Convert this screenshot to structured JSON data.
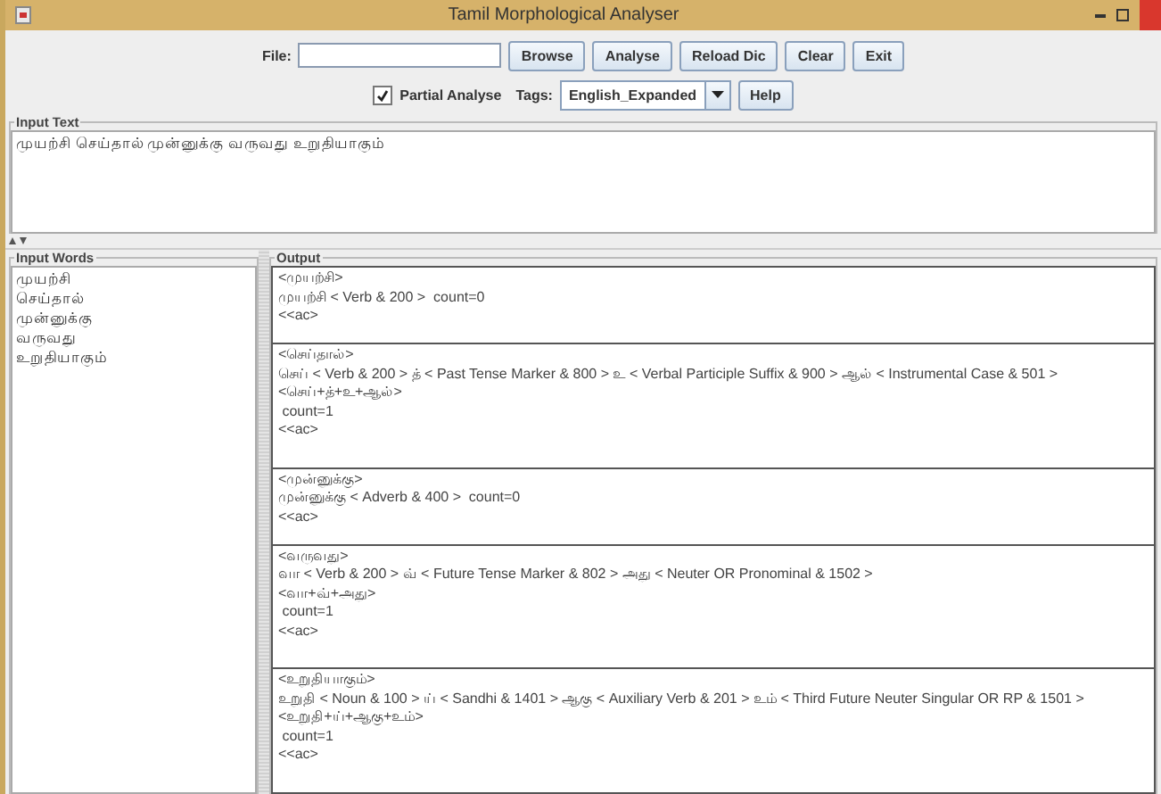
{
  "window": {
    "title": "Tamil Morphological Analyser"
  },
  "toolbar": {
    "file_label": "File:",
    "buttons": [
      "Browse",
      "Analyse",
      "Reload Dic",
      "Clear",
      "Exit"
    ],
    "partial_analyse": {
      "label": "Partial Analyse",
      "checked": true
    },
    "tags_label": "Tags:",
    "tags_value": "English_Expanded",
    "help_button": "Help"
  },
  "input_text": {
    "title": "Input Text",
    "value": "முயற்சி செய்தால் முன்னுக்கு வருவது உறுதியாகும்"
  },
  "input_words": {
    "title": "Input Words",
    "items": [
      "முயற்சி",
      "செய்தால்",
      "முன்னுக்கு",
      "வருவது",
      "உறுதியாகும்"
    ]
  },
  "output": {
    "title": "Output",
    "blocks": [
      {
        "lines": [
          "<முயற்சி>",
          "முயற்சி < Verb & 200 >  count=0",
          "<<ac>"
        ]
      },
      {
        "lines": [
          "<செய்தால்>",
          "செய் < Verb & 200 > த் < Past Tense Marker & 800 > உ < Verbal Participle Suffix & 900 > ஆல் < Instrumental Case & 501 >",
          "<செய்+த்+உ+ஆல்>",
          " count=1",
          "<<ac>"
        ]
      },
      {
        "lines": [
          "<முன்னுக்கு>",
          "முன்னுக்கு < Adverb & 400 >  count=0",
          "<<ac>"
        ]
      },
      {
        "lines": [
          "<வருவது>",
          "வா < Verb & 200 > வ் < Future Tense Marker & 802 > அது < Neuter OR Pronominal & 1502 >",
          "<வா+வ்+அது>",
          " count=1",
          "<<ac>"
        ]
      },
      {
        "lines": [
          "<உறுதியாகும்>",
          "உறுதி < Noun & 100 > ய் < Sandhi & 1401 > ஆகு < Auxiliary Verb & 201 > உம் < Third Future Neuter Singular OR RP & 1501 >",
          "<உறுதி+ய்+ஆகு+உம்>",
          " count=1",
          "<<ac>"
        ]
      }
    ]
  }
}
